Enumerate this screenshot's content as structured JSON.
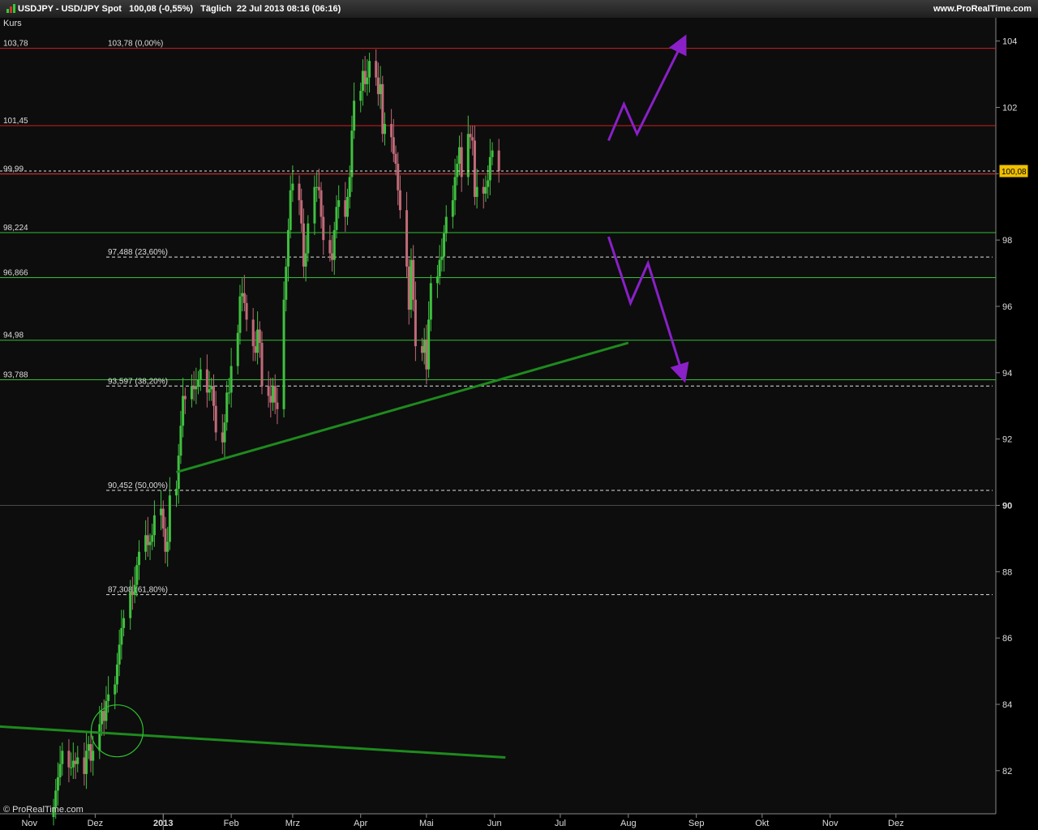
{
  "header": {
    "title": "USDJPY - USD/JPY Spot",
    "price": "100,08 (-0,55%)",
    "period": "Täglich  22 Jul 2013 08:16 (06:16)",
    "site": "www.ProRealTime.com"
  },
  "panel": {
    "label": "Kurs",
    "watermark": "© ProRealTime.com"
  },
  "colors": {
    "up": "#3fc03f",
    "down": "#c06a78",
    "resistance": "#d02020",
    "support": "#30c030",
    "trendline": "#1e8a1e",
    "projection": "#8a20c8",
    "price_tag": "#f0c000"
  },
  "chart_data": {
    "type": "candlestick",
    "ylim": [
      80.7,
      104.7
    ],
    "ticks_y": [
      82,
      84,
      86,
      88,
      90,
      92,
      94,
      96,
      98,
      100,
      102,
      104
    ],
    "ticks_y_labels": [
      "82",
      "84",
      "86",
      "88",
      "90",
      "92",
      "94",
      "96",
      "98",
      "100",
      "102",
      "104"
    ],
    "x_range": [
      "2012-11-12",
      "2013-12-31"
    ],
    "x_labels": [
      {
        "date": "2012-11-01",
        "label": "Nov"
      },
      {
        "date": "2012-12-01",
        "label": "Dez"
      },
      {
        "date": "2013-01-01",
        "label": "2013"
      },
      {
        "date": "2013-02-01",
        "label": "Feb"
      },
      {
        "date": "2013-03-01",
        "label": "Mrz"
      },
      {
        "date": "2013-04-01",
        "label": "Apr"
      },
      {
        "date": "2013-05-01",
        "label": "Mai"
      },
      {
        "date": "2013-06-01",
        "label": "Jun"
      },
      {
        "date": "2013-07-01",
        "label": "Jul"
      },
      {
        "date": "2013-08-01",
        "label": "Aug"
      },
      {
        "date": "2013-09-01",
        "label": "Sep"
      },
      {
        "date": "2013-10-01",
        "label": "Okt"
      },
      {
        "date": "2013-11-01",
        "label": "Nov"
      },
      {
        "date": "2013-12-01",
        "label": "Dez"
      }
    ],
    "last_price": 100.08,
    "last_price_label": "100,08",
    "horizontal_levels": [
      {
        "value": 103.78,
        "label": "103,78",
        "kind": "resistance"
      },
      {
        "value": 101.45,
        "label": "101,45",
        "kind": "resistance"
      },
      {
        "value": 99.99,
        "label": "99,99",
        "kind": "resistance"
      },
      {
        "value": 98.224,
        "label": "98,224",
        "kind": "support"
      },
      {
        "value": 96.866,
        "label": "96,866",
        "kind": "support"
      },
      {
        "value": 94.98,
        "label": "94,98",
        "kind": "support"
      },
      {
        "value": 93.788,
        "label": "93,788",
        "kind": "support"
      }
    ],
    "fibonacci": [
      {
        "value": 103.78,
        "label": "103,78 (0,00%)"
      },
      {
        "value": 97.488,
        "label": "97,488 (23,60%)"
      },
      {
        "value": 93.597,
        "label": "93,597 (38,20%)"
      },
      {
        "value": 90.452,
        "label": "90,452 (50,00%)"
      },
      {
        "value": 87.308,
        "label": "87,308 (61,80%)"
      }
    ],
    "trendlines": [
      {
        "from": {
          "date": "2013-01-07",
          "value": 91.0
        },
        "to": {
          "date": "2013-08-01",
          "value": 94.9
        }
      },
      {
        "from": {
          "date": "2012-10-01",
          "value": 83.4
        },
        "to": {
          "date": "2013-06-06",
          "value": 82.4
        }
      }
    ],
    "projections": [
      [
        {
          "date": "2013-07-23",
          "value": 101.0
        },
        {
          "date": "2013-07-30",
          "value": 102.1
        },
        {
          "date": "2013-08-05",
          "value": 101.2
        },
        {
          "date": "2013-08-26",
          "value": 104.0
        }
      ],
      [
        {
          "date": "2013-07-23",
          "value": 98.1
        },
        {
          "date": "2013-08-02",
          "value": 96.1
        },
        {
          "date": "2013-08-10",
          "value": 97.3
        },
        {
          "date": "2013-08-26",
          "value": 93.9
        }
      ]
    ],
    "highlight_circle": {
      "date": "2012-12-11",
      "value": 83.2
    },
    "closes": [
      80.9,
      81.4,
      81.8,
      82.2,
      82.6,
      82.1,
      82.1,
      82.3,
      82.2,
      82.4,
      81.9,
      82.6,
      82.8,
      82.3,
      82.6,
      83.4,
      83.8,
      83.5,
      84.1,
      84.3,
      84.6,
      85.2,
      85.8,
      86.3,
      86.6,
      87.4,
      87.3,
      87.6,
      88.2,
      88.6,
      89.1,
      88.8,
      88.9,
      89.1,
      89.7,
      89.9,
      89.3,
      88.6,
      88.9,
      90.3,
      90.5,
      91.5,
      92.4,
      93.3,
      93.2,
      93.6,
      93.5,
      93.6,
      93.8,
      94.1,
      93.4,
      93.5,
      93.6,
      93.0,
      92.2,
      91.9,
      92.5,
      93.4,
      93.4,
      94.2,
      95.2,
      96.3,
      96.4,
      96.1,
      95.6,
      94.8,
      94.6,
      95.3,
      94.9,
      93.6,
      93.3,
      93.1,
      93.6,
      93.1,
      92.9,
      96.2,
      97.2,
      98.3,
      99.5,
      99.7,
      99.2,
      98.5,
      97.2,
      97.6,
      98.5,
      99.6,
      99.6,
      99.5,
      98.7,
      98.0,
      97.6,
      97.4,
      98.3,
      99.0,
      99.2,
      98.7,
      99.3,
      99.9,
      101.3,
      102.2,
      102.5,
      103.1,
      102.7,
      102.9,
      103.4,
      102.9,
      102.4,
      102.7,
      101.2,
      101.5,
      101.1,
      100.6,
      100.3,
      99.5,
      98.9,
      97.2,
      95.9,
      97.4,
      96.2,
      94.8,
      94.6,
      95.0,
      94.1,
      95.6,
      96.7,
      96.9,
      97.4,
      97.5,
      98.2,
      98.7,
      99.2,
      99.9,
      100.3,
      100.8,
      99.9,
      101.2,
      101.1,
      101.0,
      99.3,
      99.6,
      99.4,
      99.6,
      99.8,
      100.5,
      100.7,
      100.08
    ]
  }
}
